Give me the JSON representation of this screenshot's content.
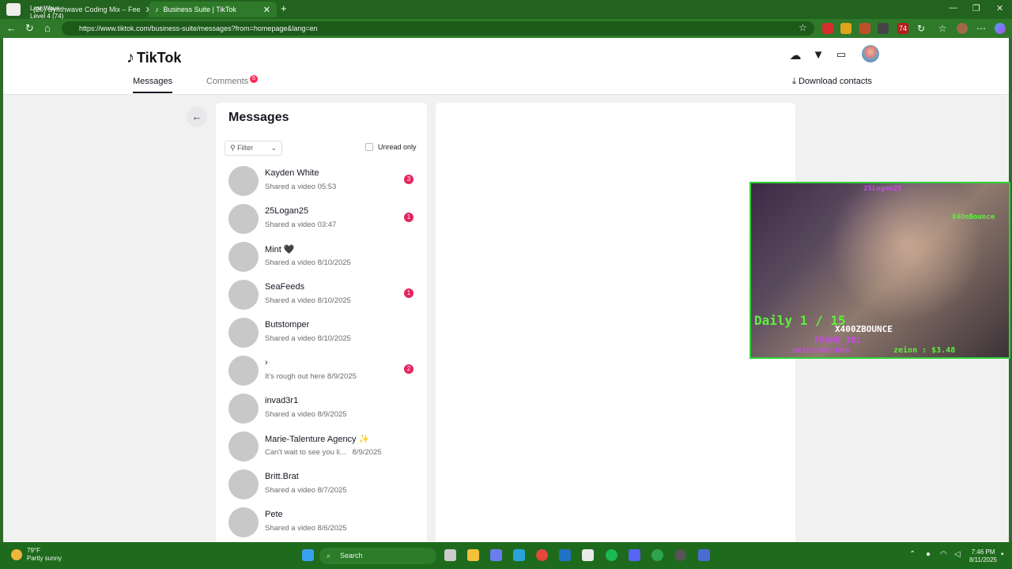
{
  "browser": {
    "tabs": [
      {
        "title": "(20) Synthwave Coding Mix – Fee"
      },
      {
        "title": "Business Suite | TikTok"
      }
    ],
    "overlay_lines": [
      "Last Wave",
      "Level 4  (74)"
    ],
    "url": "https://www.tiktok.com/business-suite/messages?from=homepage&lang=en",
    "ext_badge": "74"
  },
  "header": {
    "logo": "TikTok",
    "tabs": {
      "messages": "Messages",
      "comments": "Comments"
    },
    "comments_badge": "5",
    "download_label": "Download contacts"
  },
  "messages": {
    "title": "Messages",
    "filter_label": "Filter",
    "unread_only_label": "Unread only",
    "conversations": [
      {
        "name": "Kayden White",
        "preview": "Shared a video",
        "time": "05:53",
        "unread": "3"
      },
      {
        "name": "25Logan25",
        "preview": "Shared a video",
        "time": "03:47",
        "unread": "1"
      },
      {
        "name": "Mint 🖤",
        "preview": "Shared a video",
        "time": "8/10/2025",
        "unread": ""
      },
      {
        "name": "SeaFeeds",
        "preview": "Shared a video",
        "time": "8/10/2025",
        "unread": "1"
      },
      {
        "name": "Butstomper",
        "preview": "Shared a video",
        "time": "8/10/2025",
        "unread": ""
      },
      {
        "name": "",
        "preview": "It's rough out here",
        "time": "8/9/2025",
        "unread": "2"
      },
      {
        "name": "invad3r1",
        "preview": "Shared a video",
        "time": "8/9/2025",
        "unread": ""
      },
      {
        "name": "Marie-Talenture Agency ✨",
        "preview": "Can't wait to see you li...",
        "time": "8/9/2025",
        "unread": ""
      },
      {
        "name": "Britt.Brat",
        "preview": "Shared a video",
        "time": "8/7/2025",
        "unread": ""
      },
      {
        "name": "Pete",
        "preview": "Shared a video",
        "time": "8/6/2025",
        "unread": ""
      }
    ]
  },
  "stream_overlay": {
    "daily": "Daily 1 / 15",
    "streamer": "X400ZBOUNCE",
    "follower": "FRANK_IRL",
    "tipper": "petelotechno",
    "tip": "zeion : $3.48",
    "top": "25Logan25",
    "neon_sign": "X4OnBounce"
  },
  "taskbar": {
    "temp": "79°F",
    "weather": "Partly sunny",
    "search_label": "Search",
    "time": "7:46 PM",
    "date": "8/11/2025"
  }
}
